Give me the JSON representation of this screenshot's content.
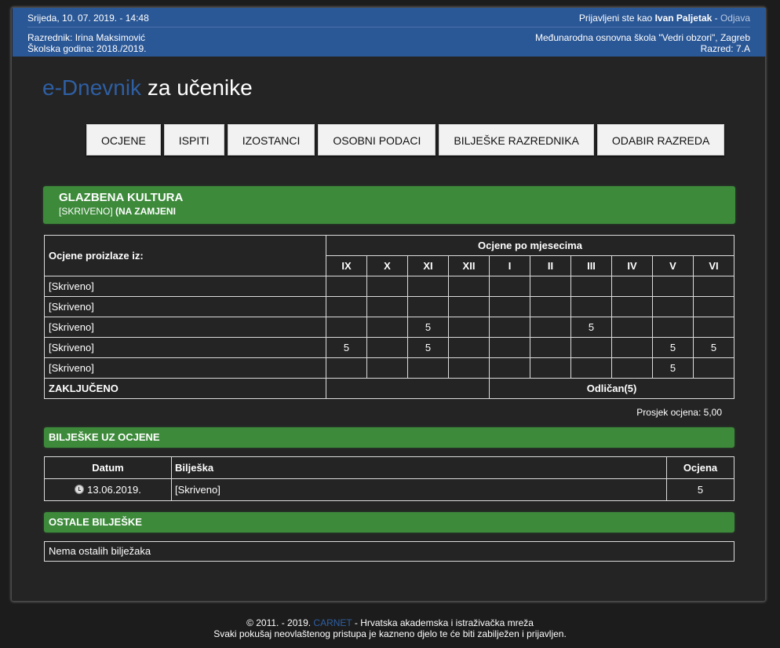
{
  "topbar": {
    "date": "Srijeda, 10. 07. 2019. - 14:48",
    "logged_prefix": "Prijavljeni ste kao ",
    "user": "Ivan Paljetak",
    "sep": " - ",
    "logout": "Odjava",
    "teacher": "Razrednik: Irina Maksimović",
    "year": "Školska godina: 2018./2019.",
    "school": "Međunarodna osnovna škola \"Vedri obzori\", Zagreb",
    "class": "Razred: 7.A"
  },
  "brand": {
    "part1": "e-Dnevnik",
    "part2": " za učenike"
  },
  "nav": [
    "OCJENE",
    "ISPITI",
    "IZOSTANCI",
    "OSOBNI PODACI",
    "BILJEŠKE RAZREDNIKA",
    "ODABIR RAZREDA"
  ],
  "subject": {
    "title": "GLAZBENA KULTURA",
    "teacher": "[SKRIVENO]",
    "note": " (NA ZAMJENI"
  },
  "grades_table": {
    "source_header": "Ocjene proizlaze iz:",
    "months_header": "Ocjene po mjesecima",
    "months": [
      "IX",
      "X",
      "XI",
      "XII",
      "I",
      "II",
      "III",
      "IV",
      "V",
      "VI"
    ],
    "rows": [
      {
        "label": "[Skriveno]",
        "values": [
          "",
          "",
          "",
          "",
          "",
          "",
          "",
          "",
          "",
          ""
        ]
      },
      {
        "label": "[Skriveno]",
        "values": [
          "",
          "",
          "",
          "",
          "",
          "",
          "",
          "",
          "",
          ""
        ]
      },
      {
        "label": "[Skriveno]",
        "values": [
          "",
          "",
          "5",
          "",
          "",
          "",
          "5",
          "",
          "",
          ""
        ]
      },
      {
        "label": "[Skriveno]",
        "values": [
          "5",
          "",
          "5",
          "",
          "",
          "",
          "",
          "",
          "5",
          "5"
        ]
      },
      {
        "label": "[Skriveno]",
        "values": [
          "",
          "",
          "",
          "",
          "",
          "",
          "",
          "",
          "5",
          ""
        ]
      }
    ],
    "final_label": "ZAKLJUČENO",
    "final_value": "Odličan(5)"
  },
  "average": "Prosjek ocjena: 5,00",
  "notes_section": {
    "title": "BILJEŠKE UZ OCJENE",
    "headers": {
      "date": "Datum",
      "note": "Bilješka",
      "grade": "Ocjena"
    },
    "row": {
      "date": "13.06.2019.",
      "note": "[Skriveno]",
      "grade": "5"
    }
  },
  "other_section": {
    "title": "OSTALE BILJEŠKE",
    "empty": "Nema ostalih bilježaka"
  },
  "footer": {
    "copy": "© 2011. - 2019. ",
    "carnet": "CARNET",
    "rest": " - Hrvatska akademska i istraživačka mreža",
    "warning": "Svaki pokušaj neovlaštenog pristupa je kazneno djelo te će biti zabilježen i prijavljen."
  }
}
